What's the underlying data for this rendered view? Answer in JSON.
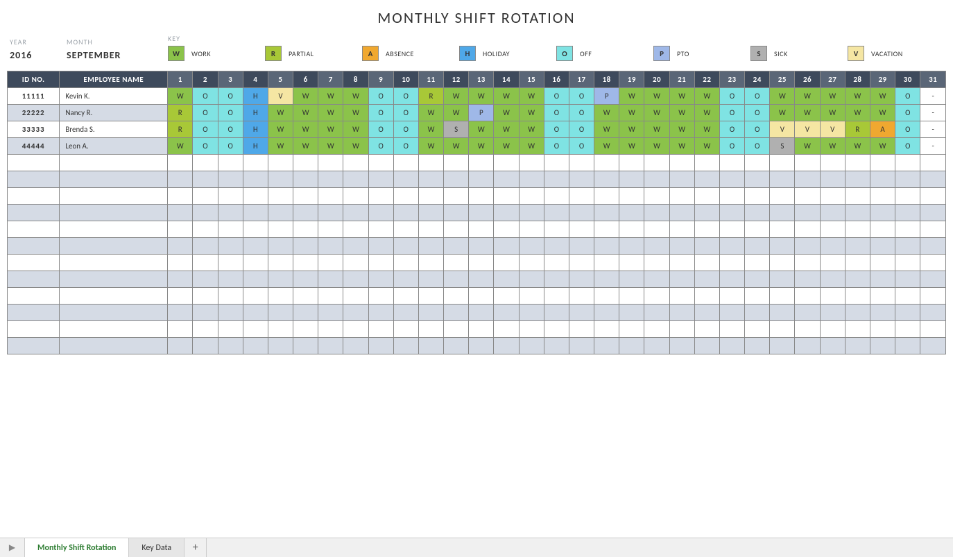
{
  "title": "MONTHLY SHIFT ROTATION",
  "labels": {
    "year": "YEAR",
    "month": "MONTH",
    "key": "KEY",
    "id": "ID NO.",
    "name": "EMPLOYEE NAME"
  },
  "year": "2016",
  "month": "SEPTEMBER",
  "key_items": [
    {
      "code": "W",
      "label": "WORK",
      "class": "c-W"
    },
    {
      "code": "R",
      "label": "PARTIAL",
      "class": "c-R"
    },
    {
      "code": "A",
      "label": "ABSENCE",
      "class": "c-A"
    },
    {
      "code": "H",
      "label": "HOLIDAY",
      "class": "c-H"
    },
    {
      "code": "O",
      "label": "OFF",
      "class": "c-O"
    },
    {
      "code": "P",
      "label": "PTO",
      "class": "c-P"
    },
    {
      "code": "S",
      "label": "SICK",
      "class": "c-S"
    },
    {
      "code": "V",
      "label": "VACATION",
      "class": "c-V"
    }
  ],
  "days": 31,
  "employees": [
    {
      "id": "11111",
      "name": "Kevin K.",
      "shifts": [
        "W",
        "O",
        "O",
        "H",
        "V",
        "W",
        "W",
        "W",
        "O",
        "O",
        "R",
        "W",
        "W",
        "W",
        "W",
        "O",
        "O",
        "P",
        "W",
        "W",
        "W",
        "W",
        "O",
        "O",
        "W",
        "W",
        "W",
        "W",
        "W",
        "O",
        "-"
      ]
    },
    {
      "id": "22222",
      "name": "Nancy R.",
      "shifts": [
        "R",
        "O",
        "O",
        "H",
        "W",
        "W",
        "W",
        "W",
        "O",
        "O",
        "W",
        "W",
        "P",
        "W",
        "W",
        "O",
        "O",
        "W",
        "W",
        "W",
        "W",
        "W",
        "O",
        "O",
        "W",
        "W",
        "W",
        "W",
        "W",
        "O",
        "-"
      ]
    },
    {
      "id": "33333",
      "name": "Brenda S.",
      "shifts": [
        "R",
        "O",
        "O",
        "H",
        "W",
        "W",
        "W",
        "W",
        "O",
        "O",
        "W",
        "S",
        "W",
        "W",
        "W",
        "O",
        "O",
        "W",
        "W",
        "W",
        "W",
        "W",
        "O",
        "O",
        "V",
        "V",
        "V",
        "R",
        "A",
        "O",
        "-"
      ]
    },
    {
      "id": "44444",
      "name": "Leon A.",
      "shifts": [
        "W",
        "O",
        "O",
        "H",
        "W",
        "W",
        "W",
        "W",
        "O",
        "O",
        "W",
        "W",
        "W",
        "W",
        "W",
        "O",
        "O",
        "W",
        "W",
        "W",
        "W",
        "W",
        "O",
        "O",
        "S",
        "W",
        "W",
        "W",
        "W",
        "O",
        "-"
      ]
    }
  ],
  "empty_rows": 12,
  "tabs": {
    "active": "Monthly Shift Rotation",
    "other": "Key Data"
  }
}
